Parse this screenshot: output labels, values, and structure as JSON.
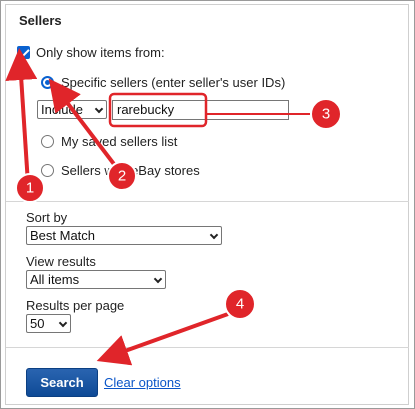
{
  "section": {
    "title": "Sellers"
  },
  "filter": {
    "only_show_label": "Only show items from:",
    "only_show_checked": true,
    "specific_sellers_label": "Specific sellers (enter seller's user IDs)",
    "include_select_value": "Include",
    "seller_input_value": "rarebucky",
    "saved_sellers_label": "My saved sellers list",
    "ebay_stores_label": "Sellers with eBay stores",
    "selected_option": "Specific sellers (enter seller's user IDs)"
  },
  "sort": {
    "label": "Sort by",
    "value": "Best Match"
  },
  "view": {
    "label": "View results",
    "value": "All items"
  },
  "per_page": {
    "label": "Results per page",
    "value": "50"
  },
  "actions": {
    "search_label": "Search",
    "clear_label": "Clear options"
  },
  "annotations": {
    "color": "#e0252a",
    "badges": [
      "1",
      "2",
      "3",
      "4"
    ]
  }
}
